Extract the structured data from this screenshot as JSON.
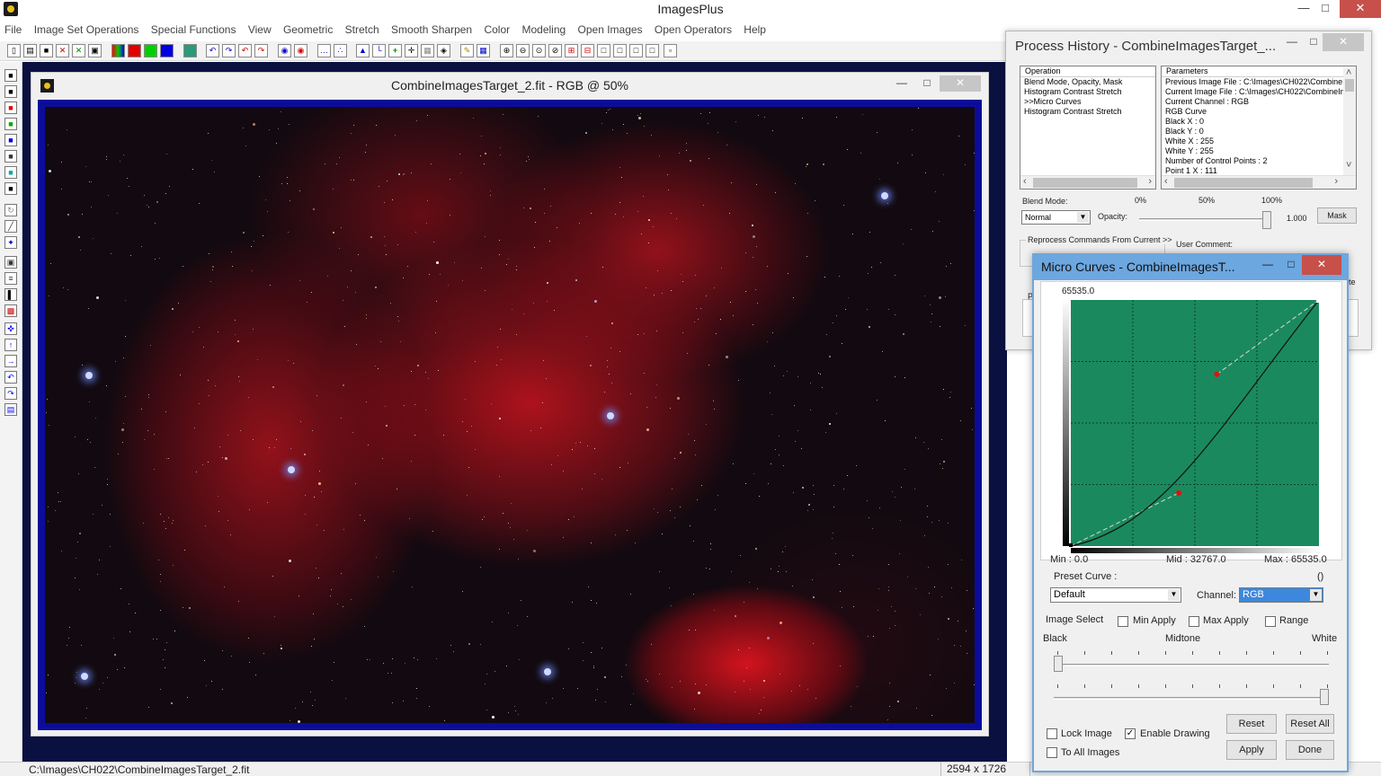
{
  "app": {
    "title": "ImagesPlus",
    "menu": [
      "File",
      "Image Set Operations",
      "Special Functions",
      "View",
      "Geometric",
      "Stretch",
      "Smooth Sharpen",
      "Color",
      "Modeling",
      "Open Images",
      "Open Operators",
      "Help"
    ]
  },
  "image_window": {
    "title": "CombineImagesTarget_2.fit - RGB @ 50%"
  },
  "status": {
    "path": "C:\\Images\\CH022\\CombineImagesTarget_2.fit",
    "dimensions": "2594 x 1726"
  },
  "history": {
    "title": "Process History - CombineImagesTarget_...",
    "operation_header": "Operation",
    "operations": [
      "Blend Mode, Opacity, Mask",
      "Histogram Contrast Stretch",
      ">>Micro Curves",
      "Histogram Contrast Stretch"
    ],
    "parameters_header": "Parameters",
    "parameters": [
      "Previous Image File : C:\\Images\\CH022\\CombineIm",
      "Current Image File : C:\\Images\\CH022\\CombineIm",
      "Current Channel : RGB",
      "RGB Curve",
      "Black X : 0",
      "Black Y : 0",
      "White X : 255",
      "White Y : 255",
      "Number of Control Points : 2",
      "Point 1 X : 111"
    ],
    "blend_mode_label": "Blend Mode:",
    "blend_mode_value": "Normal",
    "opacity_label": "Opacity:",
    "opacity_marks": [
      "0%",
      "50%",
      "100%"
    ],
    "opacity_value": "1.000",
    "opacity_fraction": 1.0,
    "mask_button": "Mask",
    "reprocess_label": "Reprocess Commands From Current >>",
    "user_comment_label": "User Comment:",
    "partial_p1": "P",
    "partial_p2": "P",
    "partial_te": "te"
  },
  "curves": {
    "title": "Micro Curves - CombineImagesT...",
    "max_axis_label": "65535.0",
    "min_label": "Min :  0.0",
    "mid_label": "Mid : 32767.0",
    "max_label": "Max : 65535.0",
    "preset_label": "Preset Curve :",
    "preset_paren": "()",
    "preset_value": "Default",
    "channel_label": "Channel:",
    "channel_value": "RGB",
    "image_select_label": "Image Select",
    "min_apply_label": "Min Apply",
    "max_apply_label": "Max Apply",
    "range_label": "Range",
    "black_label": "Black",
    "midtone_label": "Midtone",
    "white_label": "White",
    "black_slider_fraction": 0.0,
    "white_slider_fraction": 1.0,
    "lock_image_label": "Lock Image",
    "enable_drawing_label": "Enable Drawing",
    "to_all_images_label": "To All Images",
    "enable_drawing_checked": true,
    "reset_button": "Reset",
    "reset_all_button": "Reset All",
    "apply_button": "Apply",
    "done_button": "Done",
    "graph_bg_color": "#1a8a5e",
    "curve_color": "#111111",
    "control_point_color": "#e01010",
    "control_points": [
      [
        111,
        55
      ],
      [
        255,
        255
      ],
      [
        0,
        0
      ]
    ],
    "curve_points_note": "",
    "black_point": [
      0,
      0
    ],
    "white_point": [
      255,
      255
    ]
  }
}
